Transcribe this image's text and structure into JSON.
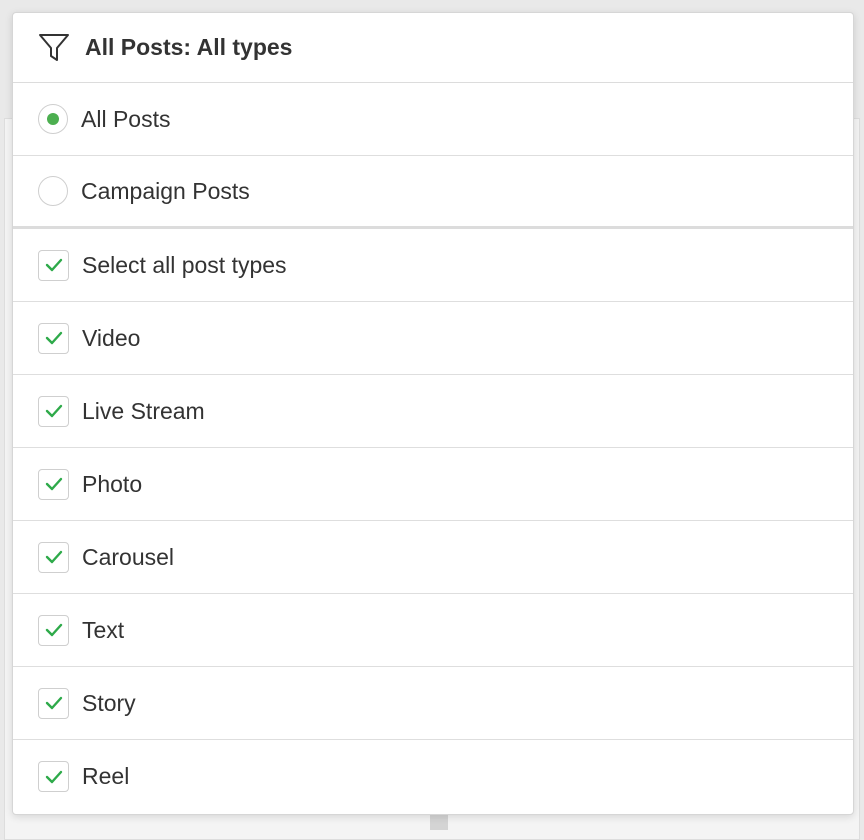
{
  "header": {
    "title": "All Posts: All types",
    "icon": "filter-icon"
  },
  "post_scope": {
    "options": [
      {
        "label": "All Posts",
        "selected": true
      },
      {
        "label": "Campaign Posts",
        "selected": false
      }
    ]
  },
  "post_types": {
    "select_all_label": "Select all post types",
    "select_all_checked": true,
    "items": [
      {
        "label": "Video",
        "checked": true
      },
      {
        "label": "Live Stream",
        "checked": true
      },
      {
        "label": "Photo",
        "checked": true
      },
      {
        "label": "Carousel",
        "checked": true
      },
      {
        "label": "Text",
        "checked": true
      },
      {
        "label": "Story",
        "checked": true
      },
      {
        "label": "Reel",
        "checked": true
      }
    ]
  },
  "colors": {
    "accent": "#4caf50",
    "check": "#2eaa4a",
    "text": "#333333",
    "border": "#dedede"
  }
}
